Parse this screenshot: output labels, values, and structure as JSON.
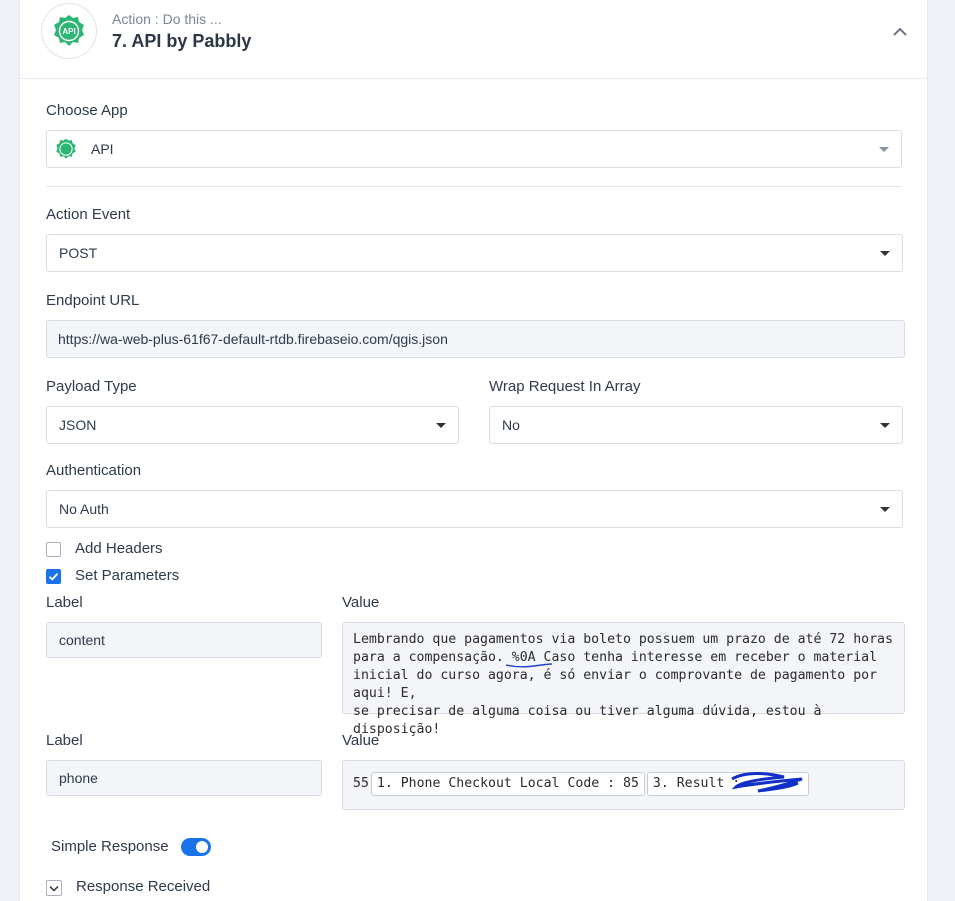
{
  "header": {
    "subtitle": "Action : Do this ...",
    "title": "7. API by Pabbly",
    "logo_text": "API",
    "accent": "#2bb673"
  },
  "choose_app": {
    "label": "Choose App",
    "value": "API"
  },
  "action_event": {
    "label": "Action Event",
    "value": "POST"
  },
  "endpoint_url": {
    "label": "Endpoint URL",
    "value": "https://wa-web-plus-61f67-default-rtdb.firebaseio.com/qgis.json"
  },
  "payload_type": {
    "label": "Payload Type",
    "value": "JSON"
  },
  "wrap_request": {
    "label": "Wrap Request In Array",
    "value": "No"
  },
  "authentication": {
    "label": "Authentication",
    "value": "No Auth"
  },
  "add_headers": {
    "label": "Add Headers",
    "checked": false
  },
  "set_parameters": {
    "label": "Set Parameters",
    "checked": true
  },
  "parameters": [
    {
      "label_heading": "Label",
      "value_heading": "Value",
      "label": "content",
      "value_lines": [
        "Lembrando que pagamentos via boleto possuem um prazo de até 72 horas",
        "para a compensação. %0A Caso tenha interesse em receber o material",
        "inicial do curso agora, é só enviar o comprovante de pagamento por aqui! E,",
        "se precisar de alguma coisa ou tiver alguma dúvida, estou à disposição!"
      ]
    },
    {
      "label_heading": "Label",
      "value_heading": "Value",
      "label": "phone",
      "prefix": "55",
      "chip1": "1. Phone Checkout Local Code : 85",
      "chip2": "3. Result :"
    }
  ],
  "simple_response": {
    "label": "Simple Response",
    "enabled": true
  },
  "response_received": {
    "label": "Response Received"
  },
  "colors": {
    "primary": "#1a73e8",
    "field_bg": "#f3f5f8",
    "border": "#d7dde5"
  }
}
